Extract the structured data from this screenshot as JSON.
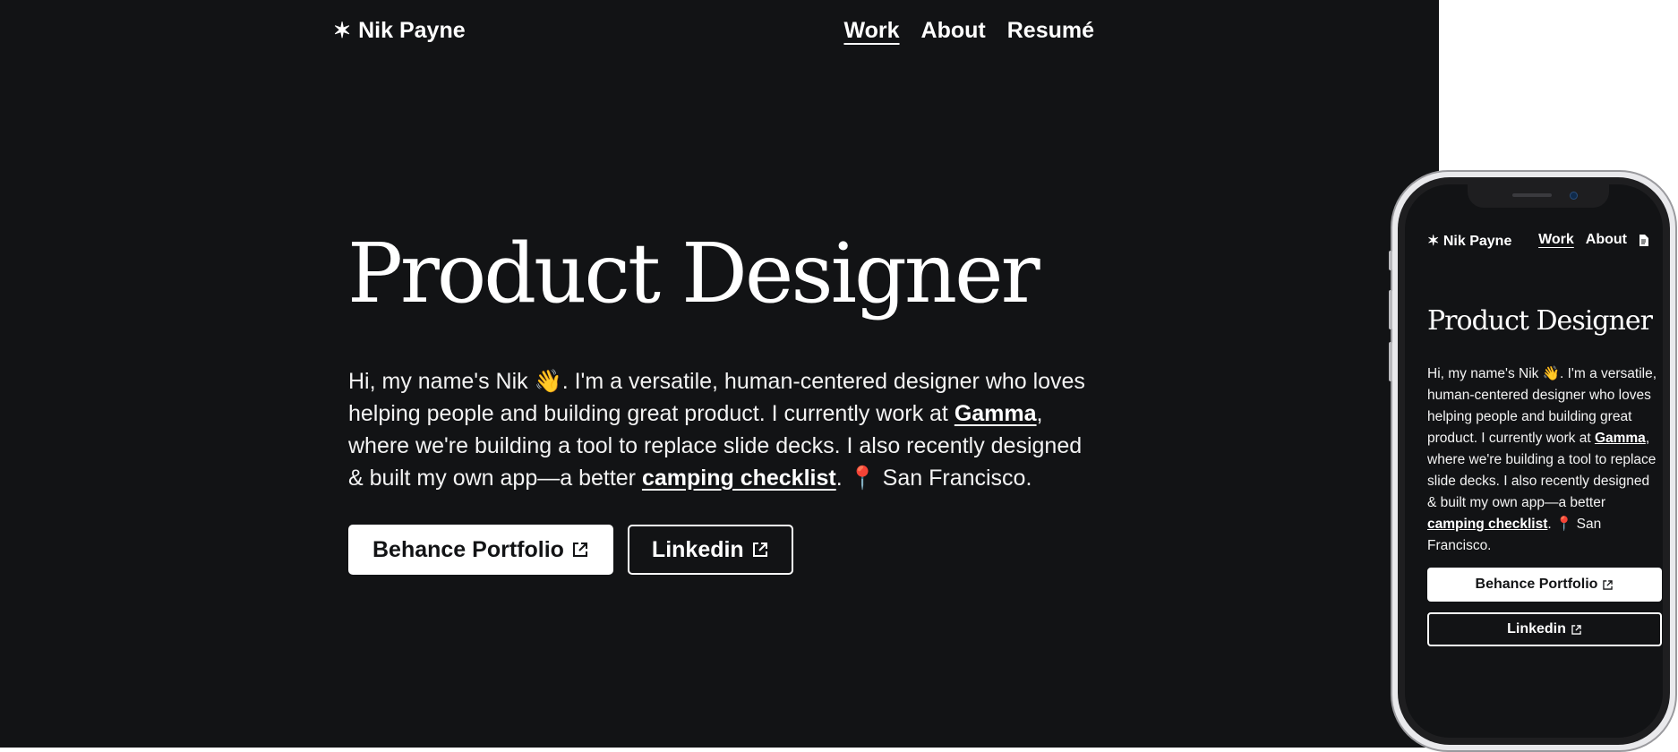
{
  "site": {
    "logo_star": "✶",
    "logo_name": "Nik Payne",
    "nav": {
      "work": "Work",
      "about": "About",
      "resume": "Resumé"
    }
  },
  "hero": {
    "title": "Product Designer",
    "bio_part1": "Hi, my name's Nik 👋. I'm a versatile, human-centered designer who loves helping people and building great product. I currently work at ",
    "gamma_link": "Gamma",
    "bio_part2": ", where we're building a tool to replace slide decks. I also recently designed & built my own app—a better ",
    "checklist_link": "camping checklist",
    "bio_part3": ". 📍 San Francisco.",
    "buttons": {
      "behance": "Behance Portfolio",
      "linkedin": "Linkedin"
    }
  },
  "mobile": {
    "nav_work": "Work",
    "nav_about": "About",
    "resume_icon": "document-icon"
  },
  "colors": {
    "background": "#121315",
    "text": "#ffffff",
    "page": "#ffffff"
  }
}
